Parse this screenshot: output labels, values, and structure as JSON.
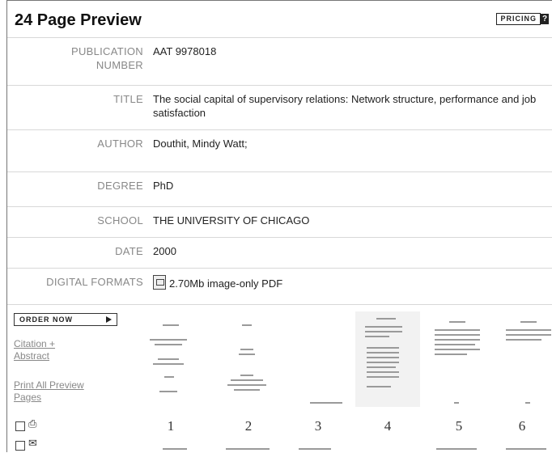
{
  "header": {
    "title": "24 Page Preview",
    "pricing_label": "PRICING",
    "pricing_help": "?"
  },
  "fields": [
    {
      "key_line1": "PUBLICATION",
      "key_line2": "NUMBER",
      "value": "AAT 9978018"
    },
    {
      "key_line1": "TITLE",
      "key_line2": "",
      "value": "The social capital of supervisory relations: Network structure, performance and job satisfaction"
    },
    {
      "key_line1": "AUTHOR",
      "key_line2": "",
      "value": "Douthit, Mindy Watt;"
    },
    {
      "key_line1": "DEGREE",
      "key_line2": "",
      "value": "PhD"
    },
    {
      "key_line1": "SCHOOL",
      "key_line2": "",
      "value": "THE UNIVERSITY OF CHICAGO"
    },
    {
      "key_line1": "DATE",
      "key_line2": "",
      "value": "2000"
    },
    {
      "key_line1": "DIGITAL FORMATS",
      "key_line2": "",
      "value": "2.70Mb image-only PDF",
      "icon": "pdf-icon"
    }
  ],
  "sidebar": {
    "order_now": "ORDER NOW",
    "citation_link": "Citation + Abstract",
    "print_link": "Print All Preview Pages",
    "icons": [
      "print-icon",
      "email-icon"
    ]
  },
  "thumbnails": {
    "page_numbers": [
      "1",
      "2",
      "3",
      "4",
      "5",
      "6"
    ]
  }
}
